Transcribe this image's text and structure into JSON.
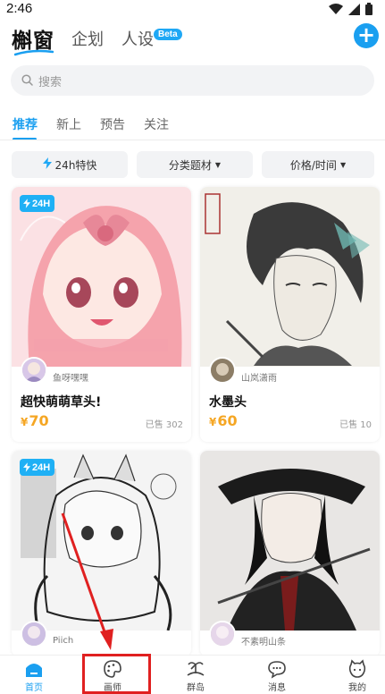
{
  "status_bar": {
    "time": "2:46"
  },
  "header": {
    "logo": "槲窗",
    "tabs": [
      "企划",
      "人设"
    ],
    "beta_badge": "Beta",
    "add_button": "+"
  },
  "search": {
    "placeholder": "搜索"
  },
  "sub_tabs": [
    {
      "label": "推荐",
      "active": true
    },
    {
      "label": "新上",
      "active": false
    },
    {
      "label": "预告",
      "active": false
    },
    {
      "label": "关注",
      "active": false
    }
  ],
  "filters": [
    {
      "label": "24h特快",
      "icon": "lightning-icon"
    },
    {
      "label": "分类题材",
      "icon": "caret-down-icon"
    },
    {
      "label": "价格/时间",
      "icon": "caret-down-icon"
    }
  ],
  "cards": [
    {
      "badge": "24H",
      "artist": "鱼呀嘿嘿",
      "title": "超快萌萌草头!",
      "currency": "¥",
      "price": "70",
      "sold": "已售 302"
    },
    {
      "badge": "",
      "artist": "山岚潇雨",
      "title": "水墨头",
      "currency": "¥",
      "price": "60",
      "sold": "已售 10"
    },
    {
      "badge": "24H",
      "artist": "Piich",
      "title": "",
      "currency": "",
      "price": "",
      "sold": ""
    },
    {
      "badge": "",
      "artist": "不素明山条",
      "title": "",
      "currency": "",
      "price": "",
      "sold": ""
    }
  ],
  "bottom_nav": [
    {
      "label": "首页",
      "icon": "home-icon",
      "active": true
    },
    {
      "label": "画师",
      "icon": "palette-icon",
      "active": false
    },
    {
      "label": "群岛",
      "icon": "island-icon",
      "active": false
    },
    {
      "label": "消息",
      "icon": "message-icon",
      "active": false
    },
    {
      "label": "我的",
      "icon": "profile-icon",
      "active": false
    }
  ],
  "colors": {
    "accent": "#1a9ff0",
    "price": "#f5a623",
    "annotation": "#e02020"
  }
}
